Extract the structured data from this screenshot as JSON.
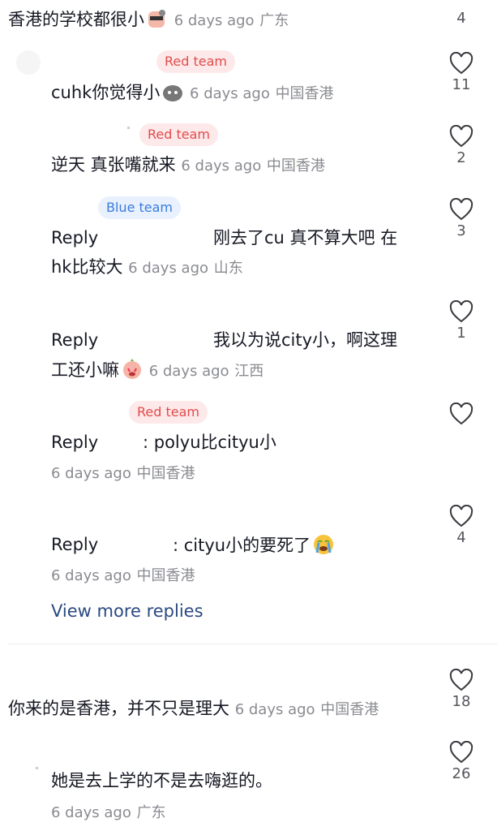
{
  "comments": [
    {
      "id": "c1",
      "text": "香港的学校都很小",
      "time": "6 days ago",
      "location": "广东",
      "likes": "4"
    },
    {
      "id": "c2",
      "text": "你来的是香港，并不只是理大",
      "time": "6 days ago",
      "location": "中国香港",
      "likes": "18"
    },
    {
      "id": "c3",
      "text": "她是去上学的不是去嗨逛的。",
      "time": "6 days ago",
      "location": "广东",
      "likes": "26"
    }
  ],
  "replies": [
    {
      "team": "Red team",
      "text": "cuhk你觉得小",
      "time": "6 days ago",
      "location": "中国香港",
      "likes": "11"
    },
    {
      "team": "Red team",
      "text": "逆天 真张嘴就来",
      "time": "6 days ago",
      "location": "中国香港",
      "likes": "2"
    },
    {
      "team": "Blue team",
      "prefix": "Reply",
      "text_line1": "刚去了cu 真不算大吧 在",
      "text_line2": "hk比较大",
      "time": "6 days ago",
      "location": "山东",
      "likes": "3"
    },
    {
      "prefix": "Reply",
      "text_line1": "我以为说city小，啊这理",
      "text_line2": "工还小嘛",
      "time": "6 days ago",
      "location": "江西",
      "likes": "1"
    },
    {
      "team": "Red team",
      "prefix": "Reply",
      "text": ": polyu比cityu小",
      "time": "6 days ago",
      "location": "中国香港",
      "likes": ""
    },
    {
      "prefix": "Reply",
      "text": ": cityu小的要死了",
      "time": "6 days ago",
      "location": "中国香港",
      "likes": "4"
    }
  ],
  "view_more": "View more replies",
  "icons": {
    "like": "heart-outline-icon"
  },
  "colors": {
    "red_badge_bg": "#fde9e9",
    "red_badge_text": "#e24c4c",
    "blue_badge_bg": "#e8f1fd",
    "blue_badge_text": "#3b7be0",
    "meta": "#8a8b91",
    "link": "#2a4a80"
  }
}
